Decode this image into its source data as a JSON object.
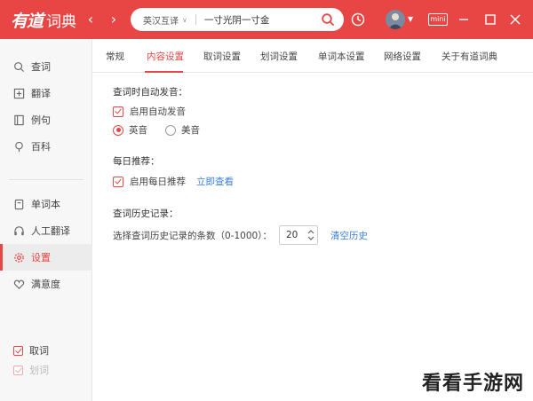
{
  "app": {
    "brand": "有道",
    "name": "词典"
  },
  "nav": {
    "back": "‹",
    "forward": "›"
  },
  "search": {
    "mode": "英汉互译",
    "query": "一寸光阴一寸金"
  },
  "window": {
    "mini_label": "mini"
  },
  "sidebar": {
    "items": [
      {
        "label": "查词",
        "icon": "search-icon"
      },
      {
        "label": "翻译",
        "icon": "translate-icon"
      },
      {
        "label": "例句",
        "icon": "example-icon"
      },
      {
        "label": "百科",
        "icon": "encyclopedia-icon"
      },
      {
        "label": "单词本",
        "icon": "wordbook-icon"
      },
      {
        "label": "人工翻译",
        "icon": "human-translate-icon"
      },
      {
        "label": "设置",
        "icon": "gear-icon",
        "active": true
      },
      {
        "label": "满意度",
        "icon": "heart-icon"
      }
    ],
    "bottom": [
      {
        "label": "取词",
        "checked": true
      },
      {
        "label": "划词",
        "checked": true
      }
    ]
  },
  "tabs": [
    {
      "label": "常规"
    },
    {
      "label": "内容设置",
      "active": true
    },
    {
      "label": "取词设置"
    },
    {
      "label": "划词设置"
    },
    {
      "label": "单词本设置"
    },
    {
      "label": "网络设置"
    },
    {
      "label": "关于有道词典"
    }
  ],
  "content": {
    "auto_pron": {
      "title": "查词时自动发音：",
      "enable_label": "启用自动发音",
      "options": [
        "英音",
        "美音"
      ],
      "selected": "英音"
    },
    "daily": {
      "title": "每日推荐：",
      "enable_label": "启用每日推荐",
      "link": "立即查看"
    },
    "history": {
      "title": "查词历史记录：",
      "label": "选择查词历史记录的条数（0-1000）：",
      "value": "20",
      "clear_link": "清空历史"
    }
  },
  "watermark": "看看手游网",
  "colors": {
    "accent": "#e84545",
    "link": "#3b7fd6",
    "sidebar_bg": "#f7f7f7"
  }
}
